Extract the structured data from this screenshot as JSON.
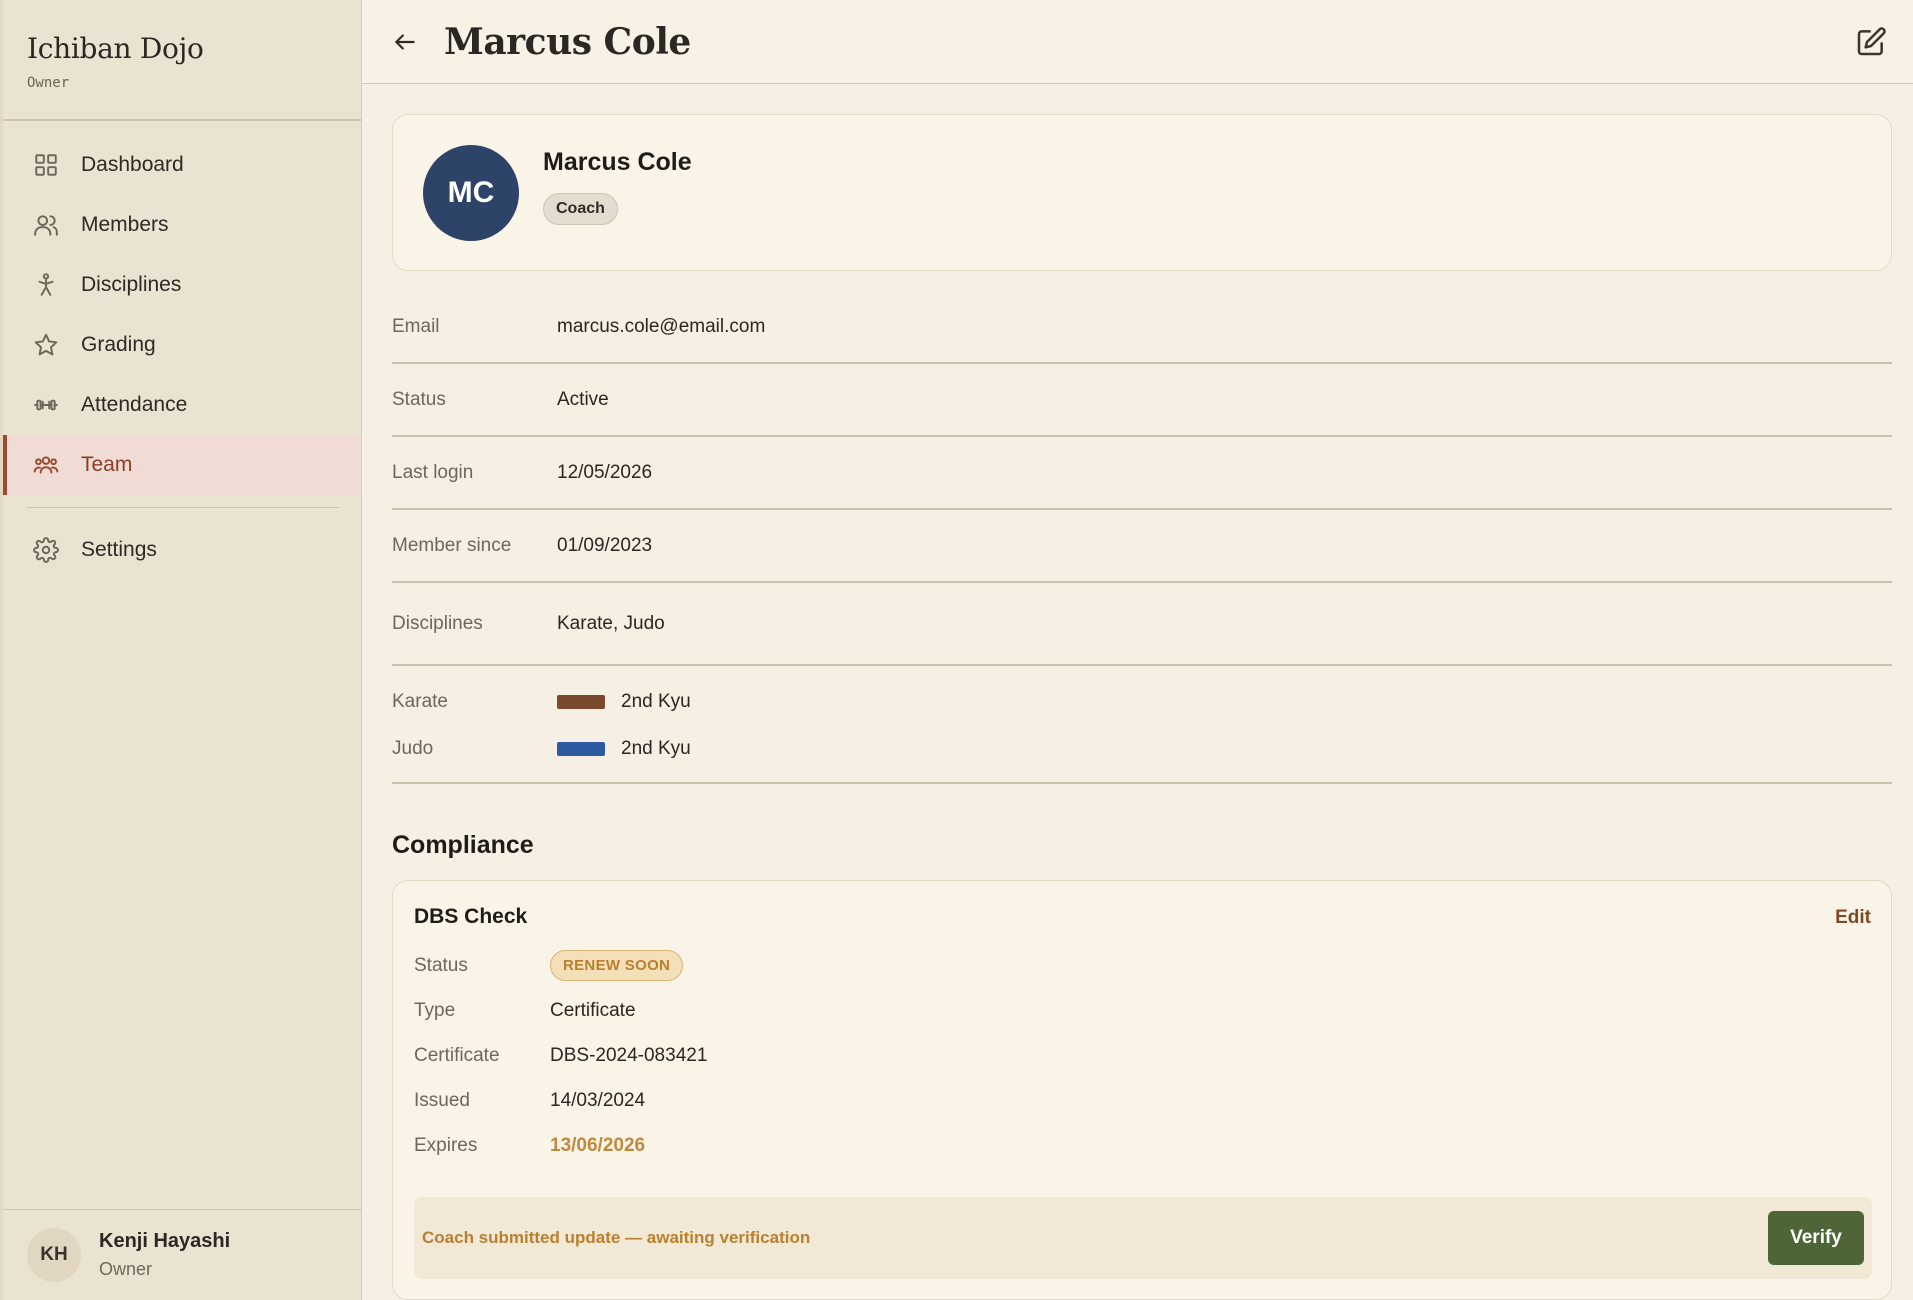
{
  "sidebar": {
    "brand_title": "Ichiban Dojo",
    "brand_role": "Owner",
    "items": [
      {
        "label": "Dashboard",
        "icon": "grid-icon"
      },
      {
        "label": "Members",
        "icon": "users-icon"
      },
      {
        "label": "Disciplines",
        "icon": "figure-icon"
      },
      {
        "label": "Grading",
        "icon": "star-icon"
      },
      {
        "label": "Attendance",
        "icon": "dumbbell-icon"
      },
      {
        "label": "Team",
        "icon": "team-icon",
        "active": true
      },
      {
        "label": "Settings",
        "icon": "gear-icon"
      }
    ],
    "user": {
      "initials": "KH",
      "name": "Kenji Hayashi",
      "role": "Owner"
    }
  },
  "header": {
    "title": "Marcus Cole"
  },
  "profile": {
    "initials": "MC",
    "name": "Marcus Cole",
    "role": "Coach",
    "avatar_color": "#2e4368"
  },
  "details": [
    {
      "label": "Email",
      "value": "marcus.cole@email.com"
    },
    {
      "label": "Status",
      "value": "Active"
    },
    {
      "label": "Last login",
      "value": "12/05/2026"
    },
    {
      "label": "Member since",
      "value": "01/09/2023"
    },
    {
      "label": "Disciplines",
      "value": "Karate, Judo"
    }
  ],
  "grades": [
    {
      "discipline": "Karate",
      "grade": "2nd Kyu",
      "belt_color": "#7a4a2e"
    },
    {
      "discipline": "Judo",
      "grade": "2nd Kyu",
      "belt_color": "#2e5aa0"
    }
  ],
  "compliance": {
    "heading": "Compliance",
    "card_title": "DBS Check",
    "edit_label": "Edit",
    "rows": {
      "status_label": "Status",
      "status_value": "RENEW SOON",
      "type_label": "Type",
      "type_value": "Certificate",
      "certificate_label": "Certificate",
      "certificate_value": "DBS-2024-083421",
      "issued_label": "Issued",
      "issued_value": "14/03/2024",
      "expires_label": "Expires",
      "expires_value": "13/06/2026"
    },
    "notice": "Coach submitted update — awaiting verification",
    "verify_label": "Verify"
  },
  "colors": {
    "accent": "#9a4a30",
    "verify": "#4e6637",
    "warning": "#b9802f"
  }
}
